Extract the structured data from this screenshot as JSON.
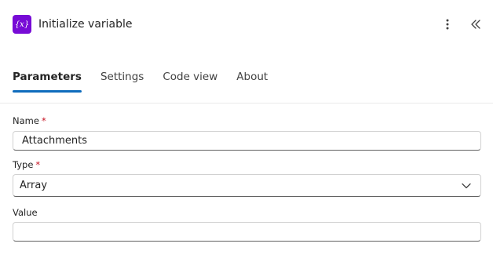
{
  "header": {
    "icon": "variable-icon",
    "icon_glyph": "{x}",
    "title": "Initialize variable",
    "more_icon": "more-vertical-icon",
    "collapse_icon": "chevron-double-left-icon"
  },
  "tabs": [
    {
      "label": "Parameters",
      "active": true
    },
    {
      "label": "Settings",
      "active": false
    },
    {
      "label": "Code view",
      "active": false
    },
    {
      "label": "About",
      "active": false
    }
  ],
  "fields": {
    "name": {
      "label": "Name",
      "required_mark": "*",
      "value": ""
    },
    "type": {
      "label": "Type",
      "required_mark": "*",
      "selected": "Array"
    },
    "value": {
      "label": "Value",
      "value": ""
    }
  },
  "name_value": "Attachments",
  "colors": {
    "accent": "#0f6cbd",
    "icon_bg": "#770bd6",
    "required": "#c50f1f"
  }
}
